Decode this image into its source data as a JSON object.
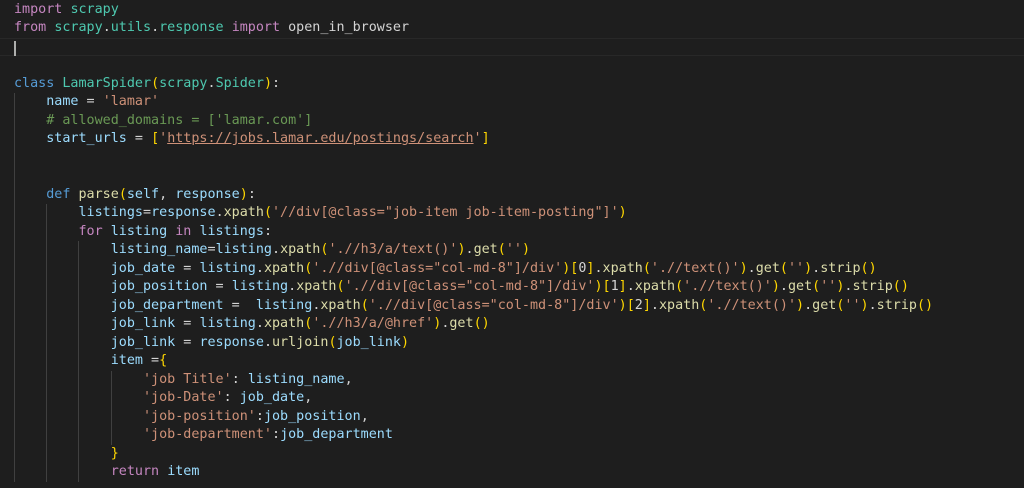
{
  "theme": {
    "background": "#1e1e1e",
    "colors": {
      "keyword": "#c586c0",
      "storage": "#569cd6",
      "function": "#dcdcaa",
      "class": "#4ec9b0",
      "variable": "#9cdcfe",
      "string": "#ce9178",
      "comment": "#6a9955",
      "default": "#d4d4d4",
      "bracket_gold": "#ffd700",
      "bracket_pink": "#da70d6",
      "bracket_blue": "#179fff"
    }
  },
  "editor": {
    "language": "python",
    "lines": [
      {
        "indent": 0,
        "tokens": [
          [
            "import",
            "keyword"
          ],
          [
            " ",
            "default"
          ],
          [
            "scrapy",
            "class"
          ]
        ]
      },
      {
        "indent": 0,
        "tokens": [
          [
            "from",
            "keyword"
          ],
          [
            " ",
            "default"
          ],
          [
            "scrapy",
            "class"
          ],
          [
            ".",
            "default"
          ],
          [
            "utils",
            "class"
          ],
          [
            ".",
            "default"
          ],
          [
            "response",
            "class"
          ],
          [
            " ",
            "default"
          ],
          [
            "import",
            "keyword"
          ],
          [
            " open_in_browser",
            "default"
          ]
        ]
      },
      {
        "indent": 0,
        "current": true,
        "cursor": true,
        "tokens": []
      },
      {
        "indent": 0,
        "tokens": []
      },
      {
        "indent": 0,
        "tokens": [
          [
            "class",
            "storage"
          ],
          [
            " ",
            "default"
          ],
          [
            "LamarSpider",
            "class"
          ],
          [
            "(",
            "bracket_gold"
          ],
          [
            "scrapy",
            "class"
          ],
          [
            ".",
            "default"
          ],
          [
            "Spider",
            "class"
          ],
          [
            ")",
            "bracket_gold"
          ],
          [
            ":",
            "default"
          ]
        ]
      },
      {
        "indent": 1,
        "tokens": [
          [
            "name",
            "variable"
          ],
          [
            " = ",
            "default"
          ],
          [
            "'lamar'",
            "string"
          ]
        ]
      },
      {
        "indent": 1,
        "tokens": [
          [
            "# allowed_domains = ['lamar.com']",
            "comment"
          ]
        ]
      },
      {
        "indent": 1,
        "tokens": [
          [
            "start_urls",
            "variable"
          ],
          [
            " = ",
            "default"
          ],
          [
            "[",
            "bracket_gold"
          ],
          [
            "'",
            "string"
          ],
          [
            "https://jobs.lamar.edu/postings/search",
            "url"
          ],
          [
            "'",
            "string"
          ],
          [
            "]",
            "bracket_gold"
          ]
        ]
      },
      {
        "indent": 1,
        "tokens": []
      },
      {
        "indent": 1,
        "tokens": []
      },
      {
        "indent": 1,
        "tokens": [
          [
            "def",
            "storage"
          ],
          [
            " ",
            "default"
          ],
          [
            "parse",
            "function"
          ],
          [
            "(",
            "bracket_gold"
          ],
          [
            "self",
            "variable"
          ],
          [
            ", ",
            "default"
          ],
          [
            "response",
            "variable"
          ],
          [
            ")",
            "bracket_gold"
          ],
          [
            ":",
            "default"
          ]
        ]
      },
      {
        "indent": 2,
        "tokens": [
          [
            "listings",
            "variable"
          ],
          [
            "=",
            "default"
          ],
          [
            "response",
            "variable"
          ],
          [
            ".",
            "default"
          ],
          [
            "xpath",
            "function"
          ],
          [
            "(",
            "bracket_gold"
          ],
          [
            "'//div[@class=\"job-item job-item-posting\"]'",
            "string"
          ],
          [
            ")",
            "bracket_gold"
          ]
        ]
      },
      {
        "indent": 2,
        "tokens": [
          [
            "for",
            "keyword"
          ],
          [
            " ",
            "default"
          ],
          [
            "listing",
            "variable"
          ],
          [
            " ",
            "default"
          ],
          [
            "in",
            "keyword"
          ],
          [
            " ",
            "default"
          ],
          [
            "listings",
            "variable"
          ],
          [
            ":",
            "default"
          ]
        ]
      },
      {
        "indent": 3,
        "tokens": [
          [
            "listing_name",
            "variable"
          ],
          [
            "=",
            "default"
          ],
          [
            "listing",
            "variable"
          ],
          [
            ".",
            "default"
          ],
          [
            "xpath",
            "function"
          ],
          [
            "(",
            "bracket_gold"
          ],
          [
            "'.//h3/a/text()'",
            "string"
          ],
          [
            ")",
            "bracket_gold"
          ],
          [
            ".",
            "default"
          ],
          [
            "get",
            "function"
          ],
          [
            "(",
            "bracket_gold"
          ],
          [
            "''",
            "string"
          ],
          [
            ")",
            "bracket_gold"
          ]
        ]
      },
      {
        "indent": 3,
        "tokens": [
          [
            "job_date",
            "variable"
          ],
          [
            " = ",
            "default"
          ],
          [
            "listing",
            "variable"
          ],
          [
            ".",
            "default"
          ],
          [
            "xpath",
            "function"
          ],
          [
            "(",
            "bracket_gold"
          ],
          [
            "'.//div[@class=\"col-md-8\"]/div'",
            "string"
          ],
          [
            ")",
            "bracket_gold"
          ],
          [
            "[",
            "bracket_gold"
          ],
          [
            "0",
            "default"
          ],
          [
            "]",
            "bracket_gold"
          ],
          [
            ".",
            "default"
          ],
          [
            "xpath",
            "function"
          ],
          [
            "(",
            "bracket_gold"
          ],
          [
            "'.//text()'",
            "string"
          ],
          [
            ")",
            "bracket_gold"
          ],
          [
            ".",
            "default"
          ],
          [
            "get",
            "function"
          ],
          [
            "(",
            "bracket_gold"
          ],
          [
            "''",
            "string"
          ],
          [
            ")",
            "bracket_gold"
          ],
          [
            ".",
            "default"
          ],
          [
            "strip",
            "function"
          ],
          [
            "(",
            "bracket_gold"
          ],
          [
            ")",
            "bracket_gold"
          ]
        ]
      },
      {
        "indent": 3,
        "tokens": [
          [
            "job_position",
            "variable"
          ],
          [
            " = ",
            "default"
          ],
          [
            "listing",
            "variable"
          ],
          [
            ".",
            "default"
          ],
          [
            "xpath",
            "function"
          ],
          [
            "(",
            "bracket_gold"
          ],
          [
            "'.//div[@class=\"col-md-8\"]/div'",
            "string"
          ],
          [
            ")",
            "bracket_gold"
          ],
          [
            "[",
            "bracket_gold"
          ],
          [
            "1",
            "default"
          ],
          [
            "]",
            "bracket_gold"
          ],
          [
            ".",
            "default"
          ],
          [
            "xpath",
            "function"
          ],
          [
            "(",
            "bracket_gold"
          ],
          [
            "'.//text()'",
            "string"
          ],
          [
            ")",
            "bracket_gold"
          ],
          [
            ".",
            "default"
          ],
          [
            "get",
            "function"
          ],
          [
            "(",
            "bracket_gold"
          ],
          [
            "''",
            "string"
          ],
          [
            ")",
            "bracket_gold"
          ],
          [
            ".",
            "default"
          ],
          [
            "strip",
            "function"
          ],
          [
            "(",
            "bracket_gold"
          ],
          [
            ")",
            "bracket_gold"
          ]
        ]
      },
      {
        "indent": 3,
        "tokens": [
          [
            "job_department",
            "variable"
          ],
          [
            " =  ",
            "default"
          ],
          [
            "listing",
            "variable"
          ],
          [
            ".",
            "default"
          ],
          [
            "xpath",
            "function"
          ],
          [
            "(",
            "bracket_gold"
          ],
          [
            "'.//div[@class=\"col-md-8\"]/div'",
            "string"
          ],
          [
            ")",
            "bracket_gold"
          ],
          [
            "[",
            "bracket_gold"
          ],
          [
            "2",
            "default"
          ],
          [
            "]",
            "bracket_gold"
          ],
          [
            ".",
            "default"
          ],
          [
            "xpath",
            "function"
          ],
          [
            "(",
            "bracket_gold"
          ],
          [
            "'.//text()'",
            "string"
          ],
          [
            ")",
            "bracket_gold"
          ],
          [
            ".",
            "default"
          ],
          [
            "get",
            "function"
          ],
          [
            "(",
            "bracket_gold"
          ],
          [
            "''",
            "string"
          ],
          [
            ")",
            "bracket_gold"
          ],
          [
            ".",
            "default"
          ],
          [
            "strip",
            "function"
          ],
          [
            "(",
            "bracket_gold"
          ],
          [
            ")",
            "bracket_gold"
          ]
        ]
      },
      {
        "indent": 3,
        "tokens": [
          [
            "job_link",
            "variable"
          ],
          [
            " = ",
            "default"
          ],
          [
            "listing",
            "variable"
          ],
          [
            ".",
            "default"
          ],
          [
            "xpath",
            "function"
          ],
          [
            "(",
            "bracket_gold"
          ],
          [
            "'.//h3/a/@href'",
            "string"
          ],
          [
            ")",
            "bracket_gold"
          ],
          [
            ".",
            "default"
          ],
          [
            "get",
            "function"
          ],
          [
            "(",
            "bracket_gold"
          ],
          [
            ")",
            "bracket_gold"
          ]
        ]
      },
      {
        "indent": 3,
        "tokens": [
          [
            "job_link",
            "variable"
          ],
          [
            " = ",
            "default"
          ],
          [
            "response",
            "variable"
          ],
          [
            ".",
            "default"
          ],
          [
            "urljoin",
            "function"
          ],
          [
            "(",
            "bracket_gold"
          ],
          [
            "job_link",
            "variable"
          ],
          [
            ")",
            "bracket_gold"
          ]
        ]
      },
      {
        "indent": 3,
        "tokens": [
          [
            "item",
            "variable"
          ],
          [
            " =",
            "default"
          ],
          [
            "{",
            "bracket_gold"
          ]
        ]
      },
      {
        "indent": 4,
        "tokens": [
          [
            "'job Title'",
            "string"
          ],
          [
            ": ",
            "default"
          ],
          [
            "listing_name",
            "variable"
          ],
          [
            ",",
            "default"
          ]
        ]
      },
      {
        "indent": 4,
        "tokens": [
          [
            "'job-Date'",
            "string"
          ],
          [
            ": ",
            "default"
          ],
          [
            "job_date",
            "variable"
          ],
          [
            ",",
            "default"
          ]
        ]
      },
      {
        "indent": 4,
        "tokens": [
          [
            "'job-position'",
            "string"
          ],
          [
            ":",
            "default"
          ],
          [
            "job_position",
            "variable"
          ],
          [
            ",",
            "default"
          ]
        ]
      },
      {
        "indent": 4,
        "tokens": [
          [
            "'job-department'",
            "string"
          ],
          [
            ":",
            "default"
          ],
          [
            "job_department",
            "variable"
          ]
        ]
      },
      {
        "indent": 3,
        "tokens": [
          [
            "}",
            "bracket_gold"
          ]
        ]
      },
      {
        "indent": 3,
        "tokens": [
          [
            "return",
            "keyword"
          ],
          [
            " ",
            "default"
          ],
          [
            "item",
            "variable"
          ]
        ]
      }
    ]
  }
}
